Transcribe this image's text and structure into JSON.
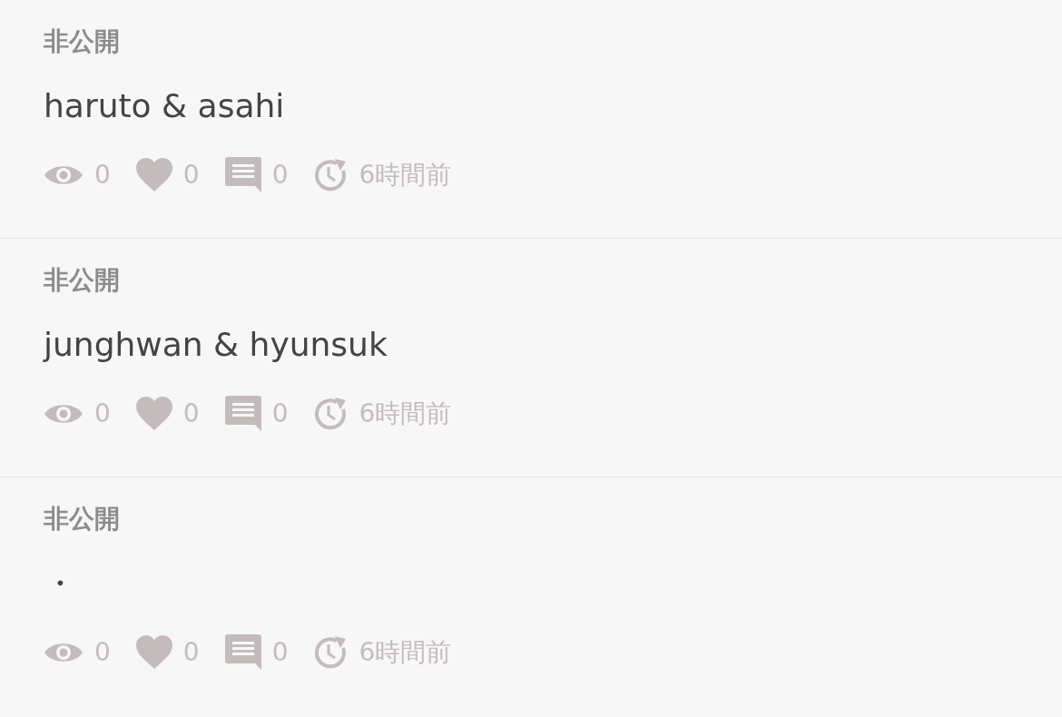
{
  "posts": [
    {
      "visibility": "非公開",
      "title": "haruto & asahi",
      "views": "0",
      "likes": "0",
      "comments": "0",
      "time": "6時間前"
    },
    {
      "visibility": "非公開",
      "title": "junghwan & hyunsuk",
      "views": "0",
      "likes": "0",
      "comments": "0",
      "time": "6時間前"
    },
    {
      "visibility": "非公開",
      "title": "・",
      "views": "0",
      "likes": "0",
      "comments": "0",
      "time": "6時間前"
    }
  ]
}
